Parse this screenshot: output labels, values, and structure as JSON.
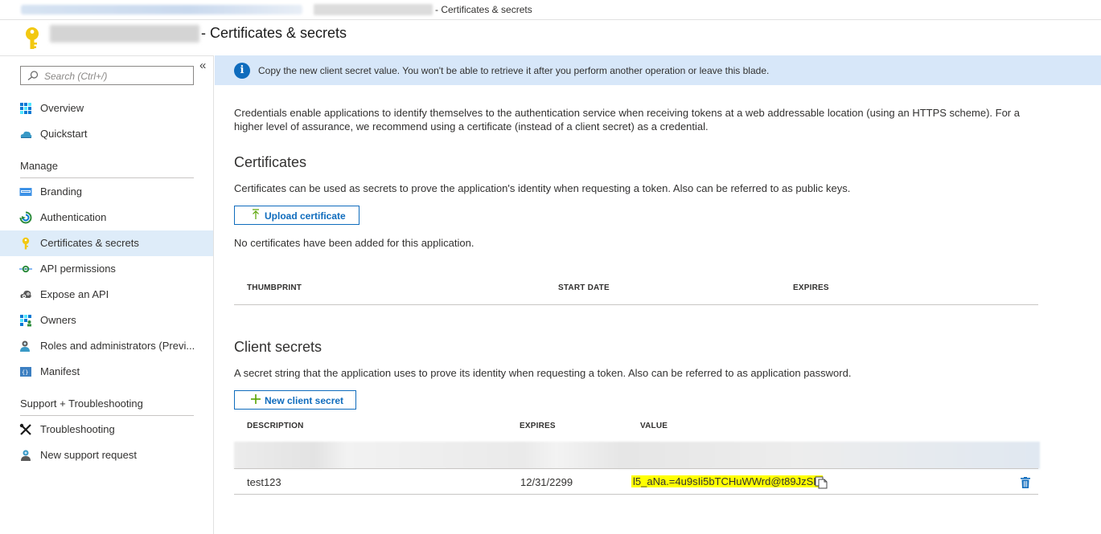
{
  "breadcrumb": {
    "suffix": "- Certificates & secrets"
  },
  "header": {
    "title_suffix": "- Certificates & secrets"
  },
  "sidebar": {
    "search_placeholder": "Search (Ctrl+/)",
    "collapse_glyph": "«",
    "top_items": [
      {
        "label": "Overview",
        "icon": "overview-grid-icon"
      },
      {
        "label": "Quickstart",
        "icon": "cloud-icon"
      }
    ],
    "manage_heading": "Manage",
    "manage_items": [
      {
        "label": "Branding",
        "icon": "branding-icon"
      },
      {
        "label": "Authentication",
        "icon": "authentication-icon"
      },
      {
        "label": "Certificates & secrets",
        "icon": "key-icon",
        "selected": true
      },
      {
        "label": "API permissions",
        "icon": "api-permissions-icon"
      },
      {
        "label": "Expose an API",
        "icon": "expose-api-icon"
      },
      {
        "label": "Owners",
        "icon": "owners-icon"
      },
      {
        "label": "Roles and administrators (Previ...",
        "icon": "roles-icon"
      },
      {
        "label": "Manifest",
        "icon": "manifest-icon"
      }
    ],
    "support_heading": "Support + Troubleshooting",
    "support_items": [
      {
        "label": "Troubleshooting",
        "icon": "wrench-icon"
      },
      {
        "label": "New support request",
        "icon": "support-person-icon"
      }
    ]
  },
  "banner": {
    "text": "Copy the new client secret value. You won't be able to retrieve it after you perform another operation or leave this blade."
  },
  "main": {
    "intro": "Credentials enable applications to identify themselves to the authentication service when receiving tokens at a web addressable location (using an HTTPS scheme). For a higher level of assurance, we recommend using a certificate (instead of a client secret) as a credential.",
    "certificates": {
      "heading": "Certificates",
      "description": "Certificates can be used as secrets to prove the application's identity when requesting a token. Also can be referred to as public keys.",
      "upload_label": "Upload certificate",
      "empty_text": "No certificates have been added for this application.",
      "columns": [
        "THUMBPRINT",
        "START DATE",
        "EXPIRES"
      ]
    },
    "secrets": {
      "heading": "Client secrets",
      "description": "A secret string that the application uses to prove its identity when requesting a token. Also can be referred to as application password.",
      "new_label": "New client secret",
      "columns": [
        "DESCRIPTION",
        "EXPIRES",
        "VALUE"
      ],
      "rows": [
        {
          "description": "test123",
          "expires": "12/31/2299",
          "value": "l5_aNa.=4u9sIi5bTCHuWWrd@t89JzSR"
        }
      ]
    }
  },
  "colors": {
    "accent": "#0f6cbd",
    "selected_bg": "#deecf9",
    "banner_bg": "#d7e7f9",
    "highlight": "#ffff00",
    "key": "#f2c811"
  }
}
